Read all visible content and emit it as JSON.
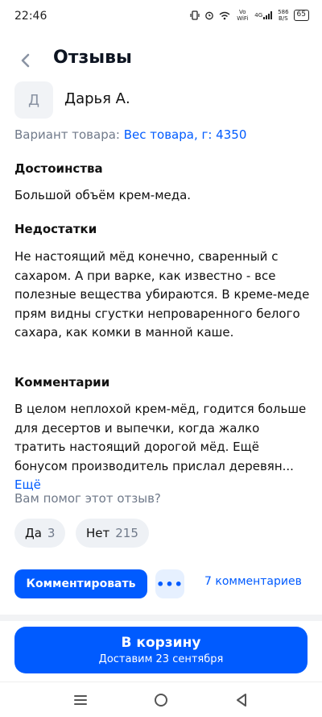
{
  "status_bar": {
    "time": "22:46",
    "network_label": "Vo WiFi",
    "signal_label": "4G",
    "speed_value": "586",
    "speed_unit": "B/S",
    "battery": "65"
  },
  "header": {
    "title": "Отзывы"
  },
  "review": {
    "avatar_letter": "Д",
    "author": "Дарья А.",
    "variant_label": "Вариант товара: ",
    "variant_value": "Вес товара, г: 4350",
    "pros_title": "Достоинства",
    "pros_text": "Большой объём крем-меда.",
    "cons_title": "Недостатки",
    "cons_text": "Не настоящий мёд конечно, сваренный с сахаром. А при варке, как известно - все полезные вещества убираются. В креме-меде прям видны сгустки непроваренного белого сахара, как комки в манной каше.",
    "comments_title": "Комментарии",
    "comments_text": "В целом неплохой крем-мёд, годится больше для десертов и выпечки, когда жалко тратить настоящий дорогой мёд. Ещё бонусом производитель прислал деревян... ",
    "more_label": "Ещё"
  },
  "helpful": {
    "question": "Вам помог этот отзыв?",
    "yes_label": "Да",
    "yes_count": "3",
    "no_label": "Нет",
    "no_count": "215"
  },
  "actions": {
    "comment_label": "Комментировать",
    "more_icon": "•••",
    "comments_count_label": "7 комментариев"
  },
  "cart": {
    "title": "В корзину",
    "subtitle": "Доставим 23 сентября"
  },
  "colors": {
    "accent": "#005bff",
    "muted": "#707a8a",
    "chip_bg": "#eef1f5"
  }
}
